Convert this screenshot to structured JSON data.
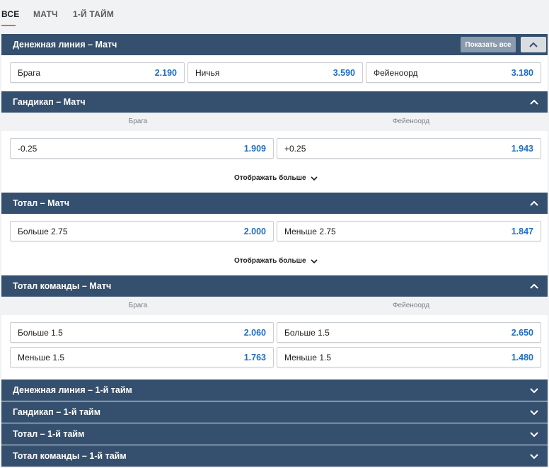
{
  "tabs": [
    "ВСЕ",
    "МАТЧ",
    "1-Й ТАЙМ"
  ],
  "show_all": "Показать все",
  "show_more": "Отображать больше",
  "colors": {
    "header": "#35506e",
    "odd_value": "#1f6fc4",
    "tab_accent": "#ef6b24"
  },
  "sections": {
    "moneyline": {
      "title": "Денежная линия – Матч",
      "odds": [
        {
          "label": "Брага",
          "value": "2.190"
        },
        {
          "label": "Ничья",
          "value": "3.590"
        },
        {
          "label": "Фейеноорд",
          "value": "3.180"
        }
      ]
    },
    "handicap": {
      "title": "Гандикап – Матч",
      "col_left": "Брага",
      "col_right": "Фейеноорд",
      "odds": [
        {
          "label": "-0.25",
          "value": "1.909"
        },
        {
          "label": "+0.25",
          "value": "1.943"
        }
      ]
    },
    "total": {
      "title": "Тотал – Матч",
      "odds": [
        {
          "label": "Больше 2.75",
          "value": "2.000"
        },
        {
          "label": "Меньше 2.75",
          "value": "1.847"
        }
      ]
    },
    "team_total": {
      "title": "Тотал команды – Матч",
      "col_left": "Брага",
      "col_right": "Фейеноорд",
      "odds": [
        {
          "label": "Больше 1.5",
          "value": "2.060"
        },
        {
          "label": "Больше 1.5",
          "value": "2.650"
        },
        {
          "label": "Меньше 1.5",
          "value": "1.763"
        },
        {
          "label": "Меньше 1.5",
          "value": "1.480"
        }
      ]
    },
    "collapsed": [
      "Денежная линия – 1-й тайм",
      "Гандикап – 1-й тайм",
      "Тотал – 1-й тайм",
      "Тотал команды – 1-й тайм"
    ]
  }
}
